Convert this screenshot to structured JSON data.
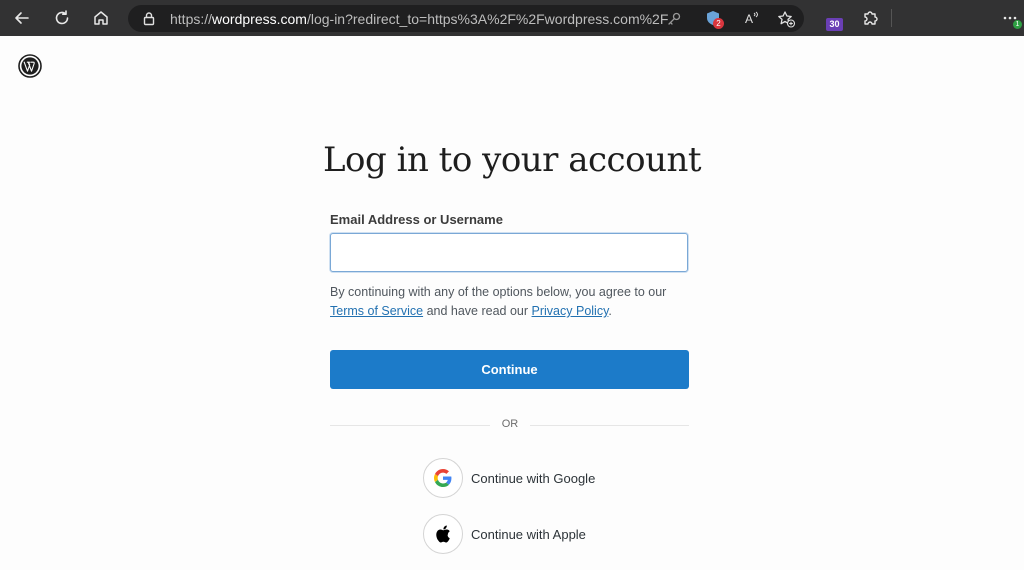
{
  "browser": {
    "url_prefix": "https://",
    "url_domain": "wordpress.com",
    "url_rest": "/log-in?redirect_to=https%3A%2F%2Fwordpress.com%2F",
    "ext_badge": "2",
    "tab_count": "30",
    "update_badge": "1"
  },
  "page": {
    "title": "Log in to your account",
    "email_label": "Email Address or Username",
    "email_value": "",
    "terms_prefix": "By continuing with any of the options below, you agree to our",
    "terms_link": "Terms of Service",
    "terms_middle": "and have read our",
    "privacy_link": "Privacy Policy",
    "terms_suffix": ".",
    "continue_label": "Continue",
    "or_label": "OR",
    "google_label": "Continue with Google",
    "apple_label": "Continue with Apple"
  },
  "colors": {
    "primary": "#1c7bc9",
    "link": "#2271b1",
    "toolbar": "#323233"
  }
}
